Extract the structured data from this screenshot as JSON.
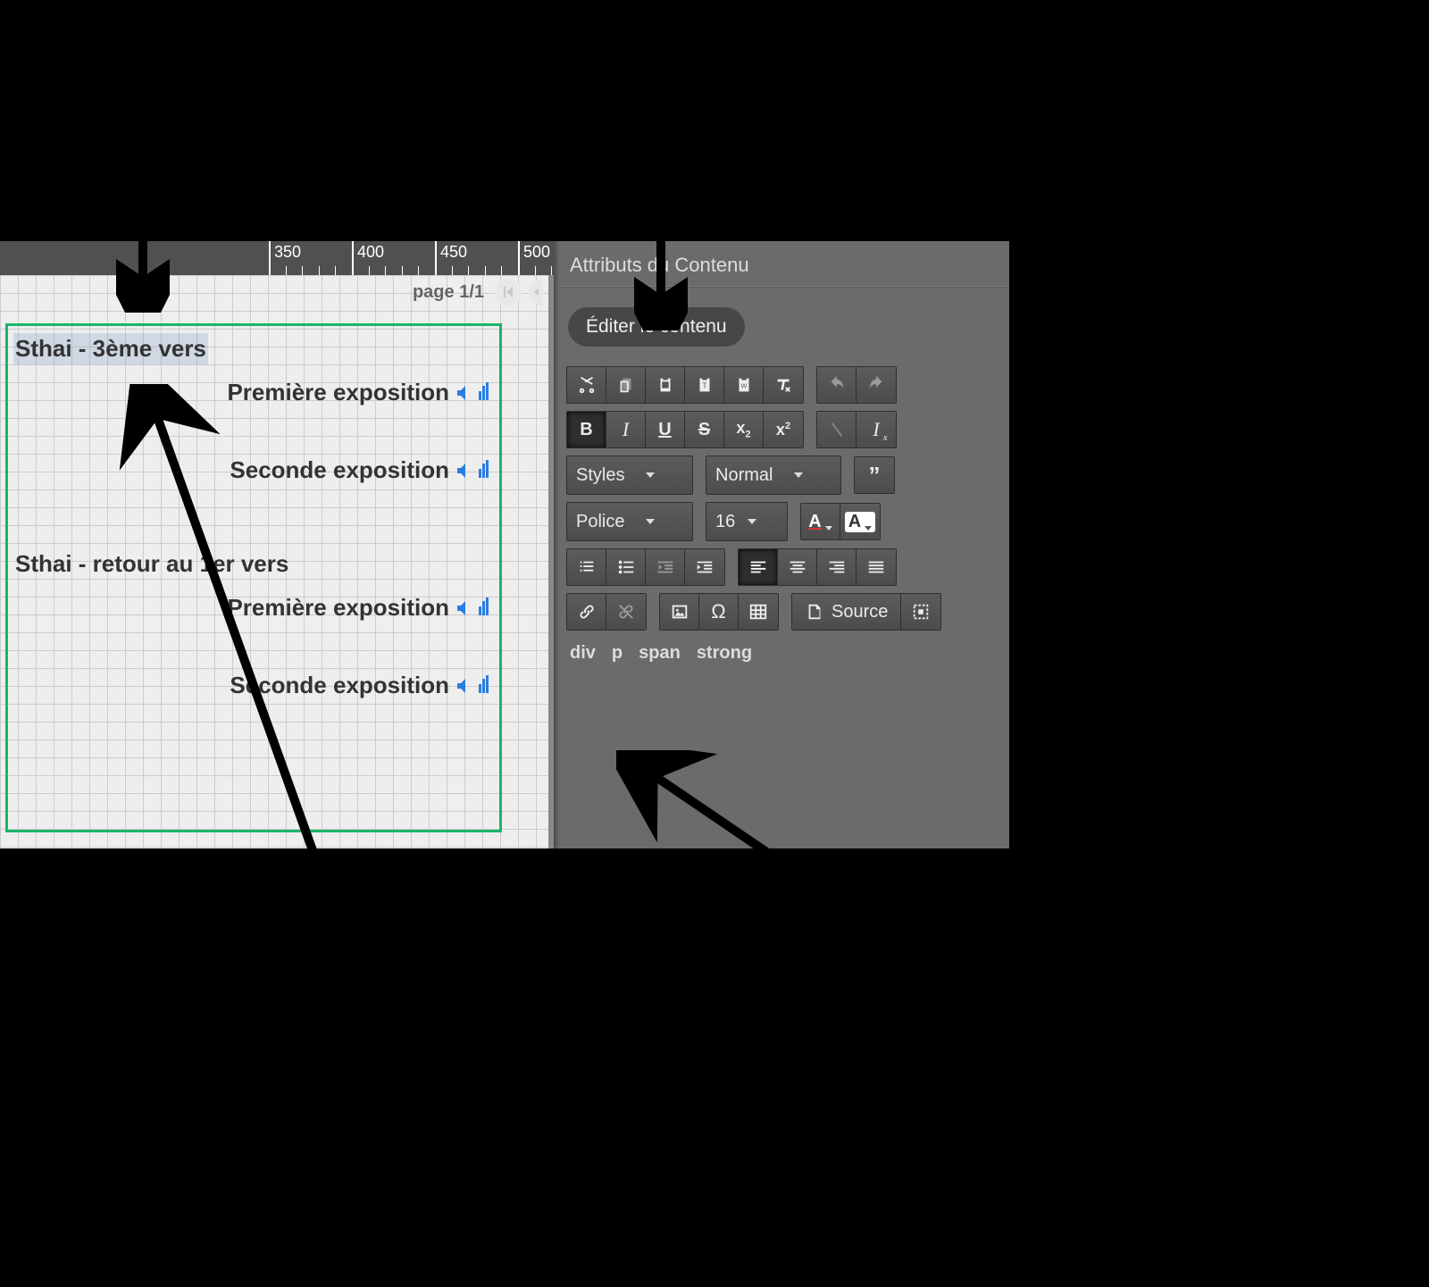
{
  "ruler": {
    "start": 350,
    "end": 660,
    "step": 50,
    "minor": 10
  },
  "page_indicator": "page 1/1",
  "content": {
    "heading1": "Sthai - 3ème vers",
    "expo1a": "Première exposition",
    "expo1b": "Seconde exposition",
    "heading2": "Sthai - retour au 1er vers",
    "expo2a": "Première exposition",
    "expo2b": "Seconde exposition"
  },
  "panel": {
    "title": "Attributs du Contenu",
    "tab": "Éditer le contenu",
    "styles_select": "Styles",
    "format_select": "Normal",
    "font_select": "Police",
    "size_select": "16",
    "source_label": "Source",
    "path": [
      "div",
      "p",
      "span",
      "strong"
    ]
  }
}
